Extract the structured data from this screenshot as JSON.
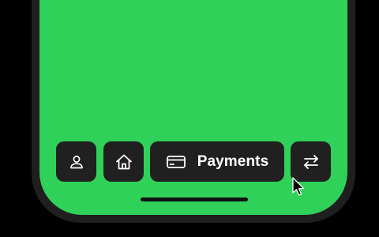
{
  "app": {
    "screen_color": "#2fd158",
    "button_color": "#202020"
  },
  "tab_bar": {
    "items": [
      {
        "id": "profile",
        "icon": "person-icon",
        "label": ""
      },
      {
        "id": "home",
        "icon": "house-icon",
        "label": ""
      },
      {
        "id": "payments",
        "icon": "credit-card-icon",
        "label": "Payments",
        "selected": true
      },
      {
        "id": "transfer",
        "icon": "arrows-left-right-icon",
        "label": ""
      }
    ]
  },
  "pointer": {
    "icon": "mouse-pointer-icon"
  }
}
